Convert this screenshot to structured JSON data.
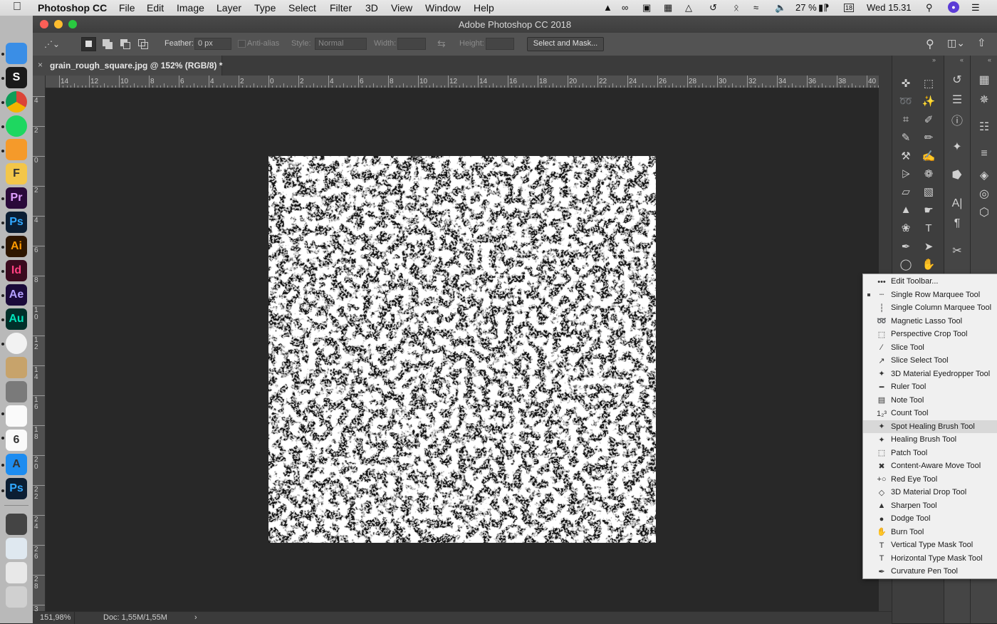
{
  "menubar": {
    "app": "Photoshop CC",
    "items": [
      "File",
      "Edit",
      "Image",
      "Layer",
      "Type",
      "Select",
      "Filter",
      "3D",
      "View",
      "Window",
      "Help"
    ],
    "battery": "27 %",
    "clock": "Wed 15.31",
    "calendar_day": "18"
  },
  "window": {
    "title": "Adobe Photoshop CC 2018"
  },
  "options": {
    "feather_label": "Feather:",
    "feather_value": "0 px",
    "antialias_label": "Anti-alias",
    "style_label": "Style:",
    "style_value": "Normal",
    "width_label": "Width:",
    "height_label": "Height:",
    "select_mask_label": "Select and Mask..."
  },
  "document": {
    "tab_title": "grain_rough_square.jpg @ 152% (RGB/8) *",
    "zoom": "151,98%",
    "doc_info": "Doc: 1,55M/1,55M"
  },
  "rulers": {
    "h_ticks": [
      "14",
      "12",
      "10",
      "8",
      "6",
      "4",
      "2",
      "0",
      "2",
      "4",
      "6",
      "8",
      "10",
      "12",
      "14",
      "16",
      "18",
      "20",
      "22",
      "24",
      "26",
      "28",
      "30",
      "32",
      "34",
      "36",
      "38",
      "40"
    ],
    "v_ticks": [
      "4",
      "2",
      "0",
      "2",
      "4",
      "6",
      "8",
      "1\n0",
      "1\n2",
      "1\n4",
      "1\n6",
      "1\n8",
      "2\n0",
      "2\n2",
      "2\n4",
      "2\n6",
      "2\n8",
      "3"
    ]
  },
  "dock": {
    "apps": [
      {
        "name": "finder",
        "label": "",
        "color": "#3a8ee6"
      },
      {
        "name": "sketch",
        "label": "S",
        "color": "#1a1a1a"
      },
      {
        "name": "chrome",
        "label": "",
        "color": "#e8e8e8"
      },
      {
        "name": "spotify",
        "label": "",
        "color": "#1ed760"
      },
      {
        "name": "airmail",
        "label": "",
        "color": "#f59a2a"
      },
      {
        "name": "fontlab",
        "label": "F",
        "color": "#f3c64a"
      },
      {
        "name": "premiere",
        "label": "Pr",
        "color": "#2a0a3a"
      },
      {
        "name": "photoshop",
        "label": "Ps",
        "color": "#0b1e33"
      },
      {
        "name": "illustrator",
        "label": "Ai",
        "color": "#2e1600"
      },
      {
        "name": "indesign",
        "label": "Id",
        "color": "#3a0a1e"
      },
      {
        "name": "aftereffects",
        "label": "Ae",
        "color": "#1a0a3a"
      },
      {
        "name": "audition",
        "label": "Au",
        "color": "#00302a"
      },
      {
        "name": "photos",
        "label": "",
        "color": "#f2f2f2"
      },
      {
        "name": "fruit-app",
        "label": "",
        "color": "#c7a36b"
      },
      {
        "name": "system-preferences",
        "label": "",
        "color": "#7a7a7a"
      },
      {
        "name": "reminders",
        "label": "",
        "color": "#fafafa"
      },
      {
        "name": "calendar",
        "label": "6",
        "color": "#fafafa"
      },
      {
        "name": "app-store",
        "label": "A",
        "color": "#1d8cf0"
      },
      {
        "name": "photoshop-2",
        "label": "Ps",
        "color": "#0b1e33"
      },
      {
        "name": "screen-recorder",
        "label": "",
        "color": "#444444"
      },
      {
        "name": "preview",
        "label": "",
        "color": "#dfe8f0"
      },
      {
        "name": "image-file",
        "label": "",
        "color": "#e8e8e8"
      },
      {
        "name": "trash",
        "label": "",
        "color": "#d0d0d0"
      }
    ]
  },
  "flyout": {
    "items": [
      {
        "label": "Edit Toolbar...",
        "icon": "•••",
        "selected": false,
        "current": false
      },
      {
        "label": "Single Row Marquee Tool",
        "icon": "┄",
        "selected": false,
        "current": true
      },
      {
        "label": "Single Column Marquee Tool",
        "icon": "┆",
        "selected": false,
        "current": false
      },
      {
        "label": "Magnetic Lasso Tool",
        "icon": "➿",
        "selected": false,
        "current": false
      },
      {
        "label": "Perspective Crop Tool",
        "icon": "⬚",
        "selected": false,
        "current": false
      },
      {
        "label": "Slice Tool",
        "icon": "∕",
        "selected": false,
        "current": false
      },
      {
        "label": "Slice Select Tool",
        "icon": "↗",
        "selected": false,
        "current": false
      },
      {
        "label": "3D Material Eyedropper Tool",
        "icon": "✦",
        "selected": false,
        "current": false
      },
      {
        "label": "Ruler Tool",
        "icon": "━",
        "selected": false,
        "current": false
      },
      {
        "label": "Note Tool",
        "icon": "▤",
        "selected": false,
        "current": false
      },
      {
        "label": "Count Tool",
        "icon": "1₂³",
        "selected": false,
        "current": false
      },
      {
        "label": "Spot Healing Brush Tool",
        "icon": "✦",
        "selected": true,
        "current": false
      },
      {
        "label": "Healing Brush Tool",
        "icon": "✦",
        "selected": false,
        "current": false
      },
      {
        "label": "Patch Tool",
        "icon": "⬚",
        "selected": false,
        "current": false
      },
      {
        "label": "Content-Aware Move Tool",
        "icon": "✖",
        "selected": false,
        "current": false
      },
      {
        "label": "Red Eye Tool",
        "icon": "+○",
        "selected": false,
        "current": false
      },
      {
        "label": "3D Material Drop Tool",
        "icon": "◇",
        "selected": false,
        "current": false
      },
      {
        "label": "Sharpen Tool",
        "icon": "▲",
        "selected": false,
        "current": false
      },
      {
        "label": "Dodge Tool",
        "icon": "●",
        "selected": false,
        "current": false
      },
      {
        "label": "Burn Tool",
        "icon": "✋",
        "selected": false,
        "current": false
      },
      {
        "label": "Vertical Type Mask Tool",
        "icon": "T",
        "selected": false,
        "current": false
      },
      {
        "label": "Horizontal Type Mask Tool",
        "icon": "T",
        "selected": false,
        "current": false
      },
      {
        "label": "Curvature Pen Tool",
        "icon": "✒",
        "selected": false,
        "current": false
      }
    ]
  },
  "tools": [
    {
      "name": "move-tool",
      "glyph": "✜"
    },
    {
      "name": "rectangular-marquee-tool",
      "glyph": "⬚"
    },
    {
      "name": "lasso-tool",
      "glyph": "➿"
    },
    {
      "name": "magic-wand-tool",
      "glyph": "✨"
    },
    {
      "name": "crop-tool",
      "glyph": "⌗"
    },
    {
      "name": "eyedropper-tool",
      "glyph": "✐"
    },
    {
      "name": "spot-healing-brush-tool",
      "glyph": "✎"
    },
    {
      "name": "pencil-tool",
      "glyph": "✏"
    },
    {
      "name": "clone-stamp-tool",
      "glyph": "⚒"
    },
    {
      "name": "history-brush-tool",
      "glyph": "✍"
    },
    {
      "name": "stamp-tool",
      "glyph": "⩥"
    },
    {
      "name": "art-history-brush-tool",
      "glyph": "❁"
    },
    {
      "name": "eraser-tool",
      "glyph": "▱"
    },
    {
      "name": "gradient-tool",
      "glyph": "▧"
    },
    {
      "name": "blur-tool",
      "glyph": "▲"
    },
    {
      "name": "smudge-tool",
      "glyph": "☛"
    },
    {
      "name": "sponge-tool",
      "glyph": "❀"
    },
    {
      "name": "type-tool",
      "glyph": "T"
    },
    {
      "name": "pen-tool",
      "glyph": "✒"
    },
    {
      "name": "path-selection-tool",
      "glyph": "➤"
    },
    {
      "name": "ellipse-tool",
      "glyph": "◯"
    },
    {
      "name": "hand-tool",
      "glyph": "✋"
    }
  ],
  "panels_col1": [
    {
      "name": "history-panel-icon",
      "glyph": "↺"
    },
    {
      "name": "properties-panel-icon",
      "glyph": "☰"
    },
    {
      "name": "info-panel-icon",
      "glyph": "ⓘ"
    },
    {
      "name": "brushes-panel-icon",
      "glyph": "✦"
    },
    {
      "name": "clone-source-panel-icon",
      "glyph": "⭓"
    },
    {
      "name": "character-panel-icon",
      "glyph": "A|"
    },
    {
      "name": "paragraph-panel-icon",
      "glyph": "¶"
    },
    {
      "name": "tools-preset-icon",
      "glyph": "✂"
    }
  ],
  "panels_col2": [
    {
      "name": "swatches-panel-icon",
      "glyph": "▦"
    },
    {
      "name": "color-panel-icon",
      "glyph": "✵"
    },
    {
      "name": "adjustments-panel-icon",
      "glyph": "☷"
    },
    {
      "name": "libraries-panel-icon",
      "glyph": "≡"
    },
    {
      "name": "layers-panel-icon",
      "glyph": "◈"
    },
    {
      "name": "channels-panel-icon",
      "glyph": "◎"
    },
    {
      "name": "paths-panel-icon",
      "glyph": "⬡"
    }
  ]
}
